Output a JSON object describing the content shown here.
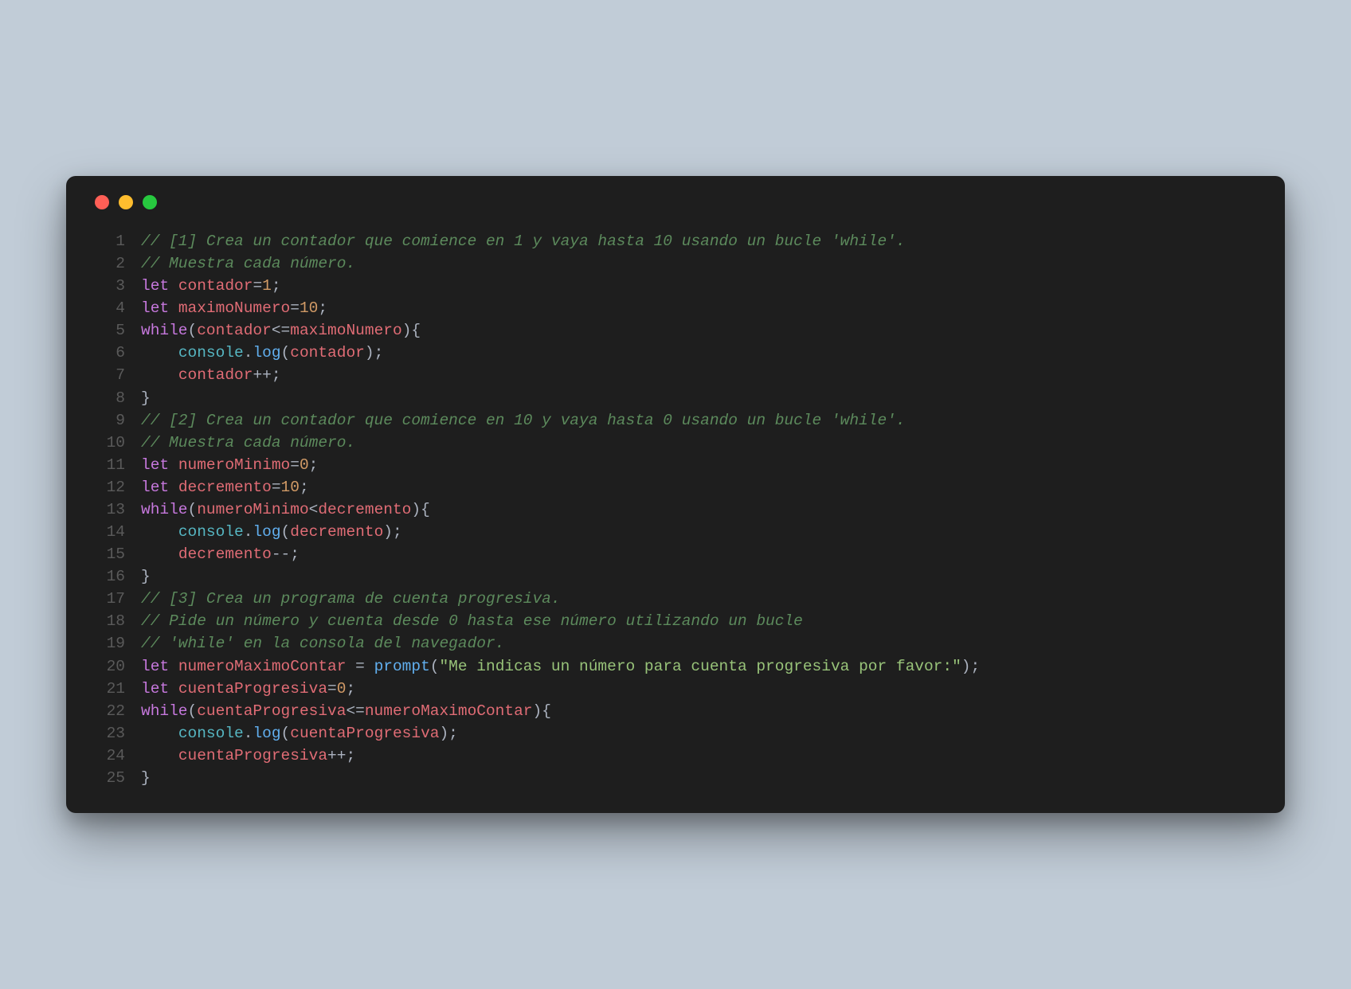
{
  "window": {
    "dots": [
      "red",
      "yellow",
      "green"
    ]
  },
  "lines": [
    {
      "n": "1",
      "tokens": [
        {
          "c": "tok-comment",
          "t": "// [1] Crea un contador que comience en 1 y vaya hasta 10 usando un bucle 'while'."
        }
      ]
    },
    {
      "n": "2",
      "tokens": [
        {
          "c": "tok-comment",
          "t": "// Muestra cada número."
        }
      ]
    },
    {
      "n": "3",
      "tokens": [
        {
          "c": "tok-keyword",
          "t": "let"
        },
        {
          "c": "tok-default",
          "t": " "
        },
        {
          "c": "tok-var",
          "t": "contador"
        },
        {
          "c": "tok-punct",
          "t": "="
        },
        {
          "c": "tok-number",
          "t": "1"
        },
        {
          "c": "tok-punct",
          "t": ";"
        }
      ]
    },
    {
      "n": "4",
      "tokens": [
        {
          "c": "tok-keyword",
          "t": "let"
        },
        {
          "c": "tok-default",
          "t": " "
        },
        {
          "c": "tok-var",
          "t": "maximoNumero"
        },
        {
          "c": "tok-punct",
          "t": "="
        },
        {
          "c": "tok-number",
          "t": "10"
        },
        {
          "c": "tok-punct",
          "t": ";"
        }
      ]
    },
    {
      "n": "5",
      "tokens": [
        {
          "c": "tok-keyword",
          "t": "while"
        },
        {
          "c": "tok-punct",
          "t": "("
        },
        {
          "c": "tok-var",
          "t": "contador"
        },
        {
          "c": "tok-punct",
          "t": "<="
        },
        {
          "c": "tok-var",
          "t": "maximoNumero"
        },
        {
          "c": "tok-punct",
          "t": "){"
        }
      ]
    },
    {
      "n": "6",
      "tokens": [
        {
          "c": "tok-default",
          "t": "    "
        },
        {
          "c": "tok-property",
          "t": "console"
        },
        {
          "c": "tok-punct",
          "t": "."
        },
        {
          "c": "tok-method",
          "t": "log"
        },
        {
          "c": "tok-punct",
          "t": "("
        },
        {
          "c": "tok-var",
          "t": "contador"
        },
        {
          "c": "tok-punct",
          "t": ");"
        }
      ]
    },
    {
      "n": "7",
      "tokens": [
        {
          "c": "tok-default",
          "t": "    "
        },
        {
          "c": "tok-var",
          "t": "contador"
        },
        {
          "c": "tok-punct",
          "t": "++;"
        }
      ]
    },
    {
      "n": "8",
      "tokens": [
        {
          "c": "tok-punct",
          "t": "}"
        }
      ]
    },
    {
      "n": "9",
      "tokens": [
        {
          "c": "tok-comment",
          "t": "// [2] Crea un contador que comience en 10 y vaya hasta 0 usando un bucle 'while'."
        }
      ]
    },
    {
      "n": "10",
      "tokens": [
        {
          "c": "tok-comment",
          "t": "// Muestra cada número."
        }
      ]
    },
    {
      "n": "11",
      "tokens": [
        {
          "c": "tok-keyword",
          "t": "let"
        },
        {
          "c": "tok-default",
          "t": " "
        },
        {
          "c": "tok-var",
          "t": "numeroMinimo"
        },
        {
          "c": "tok-punct",
          "t": "="
        },
        {
          "c": "tok-number",
          "t": "0"
        },
        {
          "c": "tok-punct",
          "t": ";"
        }
      ]
    },
    {
      "n": "12",
      "tokens": [
        {
          "c": "tok-keyword",
          "t": "let"
        },
        {
          "c": "tok-default",
          "t": " "
        },
        {
          "c": "tok-var",
          "t": "decremento"
        },
        {
          "c": "tok-punct",
          "t": "="
        },
        {
          "c": "tok-number",
          "t": "10"
        },
        {
          "c": "tok-punct",
          "t": ";"
        }
      ]
    },
    {
      "n": "13",
      "tokens": [
        {
          "c": "tok-keyword",
          "t": "while"
        },
        {
          "c": "tok-punct",
          "t": "("
        },
        {
          "c": "tok-var",
          "t": "numeroMinimo"
        },
        {
          "c": "tok-punct",
          "t": "<"
        },
        {
          "c": "tok-var",
          "t": "decremento"
        },
        {
          "c": "tok-punct",
          "t": "){"
        }
      ]
    },
    {
      "n": "14",
      "tokens": [
        {
          "c": "tok-default",
          "t": "    "
        },
        {
          "c": "tok-property",
          "t": "console"
        },
        {
          "c": "tok-punct",
          "t": "."
        },
        {
          "c": "tok-method",
          "t": "log"
        },
        {
          "c": "tok-punct",
          "t": "("
        },
        {
          "c": "tok-var",
          "t": "decremento"
        },
        {
          "c": "tok-punct",
          "t": ");"
        }
      ]
    },
    {
      "n": "15",
      "tokens": [
        {
          "c": "tok-default",
          "t": "    "
        },
        {
          "c": "tok-var",
          "t": "decremento"
        },
        {
          "c": "tok-punct",
          "t": "--;"
        }
      ]
    },
    {
      "n": "16",
      "tokens": [
        {
          "c": "tok-punct",
          "t": "}"
        }
      ]
    },
    {
      "n": "17",
      "tokens": [
        {
          "c": "tok-comment",
          "t": "// [3] Crea un programa de cuenta progresiva."
        }
      ]
    },
    {
      "n": "18",
      "tokens": [
        {
          "c": "tok-comment",
          "t": "// Pide un número y cuenta desde 0 hasta ese número utilizando un bucle"
        }
      ]
    },
    {
      "n": "19",
      "tokens": [
        {
          "c": "tok-comment",
          "t": "// 'while' en la consola del navegador."
        }
      ]
    },
    {
      "n": "20",
      "tokens": [
        {
          "c": "tok-keyword",
          "t": "let"
        },
        {
          "c": "tok-default",
          "t": " "
        },
        {
          "c": "tok-var",
          "t": "numeroMaximoContar"
        },
        {
          "c": "tok-default",
          "t": " "
        },
        {
          "c": "tok-punct",
          "t": "="
        },
        {
          "c": "tok-default",
          "t": " "
        },
        {
          "c": "tok-method",
          "t": "prompt"
        },
        {
          "c": "tok-punct",
          "t": "("
        },
        {
          "c": "tok-string",
          "t": "\"Me indicas un número para cuenta progresiva por favor:\""
        },
        {
          "c": "tok-punct",
          "t": ");"
        }
      ]
    },
    {
      "n": "21",
      "tokens": [
        {
          "c": "tok-keyword",
          "t": "let"
        },
        {
          "c": "tok-default",
          "t": " "
        },
        {
          "c": "tok-var",
          "t": "cuentaProgresiva"
        },
        {
          "c": "tok-punct",
          "t": "="
        },
        {
          "c": "tok-number",
          "t": "0"
        },
        {
          "c": "tok-punct",
          "t": ";"
        }
      ]
    },
    {
      "n": "22",
      "tokens": [
        {
          "c": "tok-keyword",
          "t": "while"
        },
        {
          "c": "tok-punct",
          "t": "("
        },
        {
          "c": "tok-var",
          "t": "cuentaProgresiva"
        },
        {
          "c": "tok-punct",
          "t": "<="
        },
        {
          "c": "tok-var",
          "t": "numeroMaximoContar"
        },
        {
          "c": "tok-punct",
          "t": "){"
        }
      ]
    },
    {
      "n": "23",
      "tokens": [
        {
          "c": "tok-default",
          "t": "    "
        },
        {
          "c": "tok-property",
          "t": "console"
        },
        {
          "c": "tok-punct",
          "t": "."
        },
        {
          "c": "tok-method",
          "t": "log"
        },
        {
          "c": "tok-punct",
          "t": "("
        },
        {
          "c": "tok-var",
          "t": "cuentaProgresiva"
        },
        {
          "c": "tok-punct",
          "t": ");"
        }
      ]
    },
    {
      "n": "24",
      "tokens": [
        {
          "c": "tok-default",
          "t": "    "
        },
        {
          "c": "tok-var",
          "t": "cuentaProgresiva"
        },
        {
          "c": "tok-punct",
          "t": "++;"
        }
      ]
    },
    {
      "n": "25",
      "tokens": [
        {
          "c": "tok-punct",
          "t": "}"
        }
      ]
    }
  ]
}
